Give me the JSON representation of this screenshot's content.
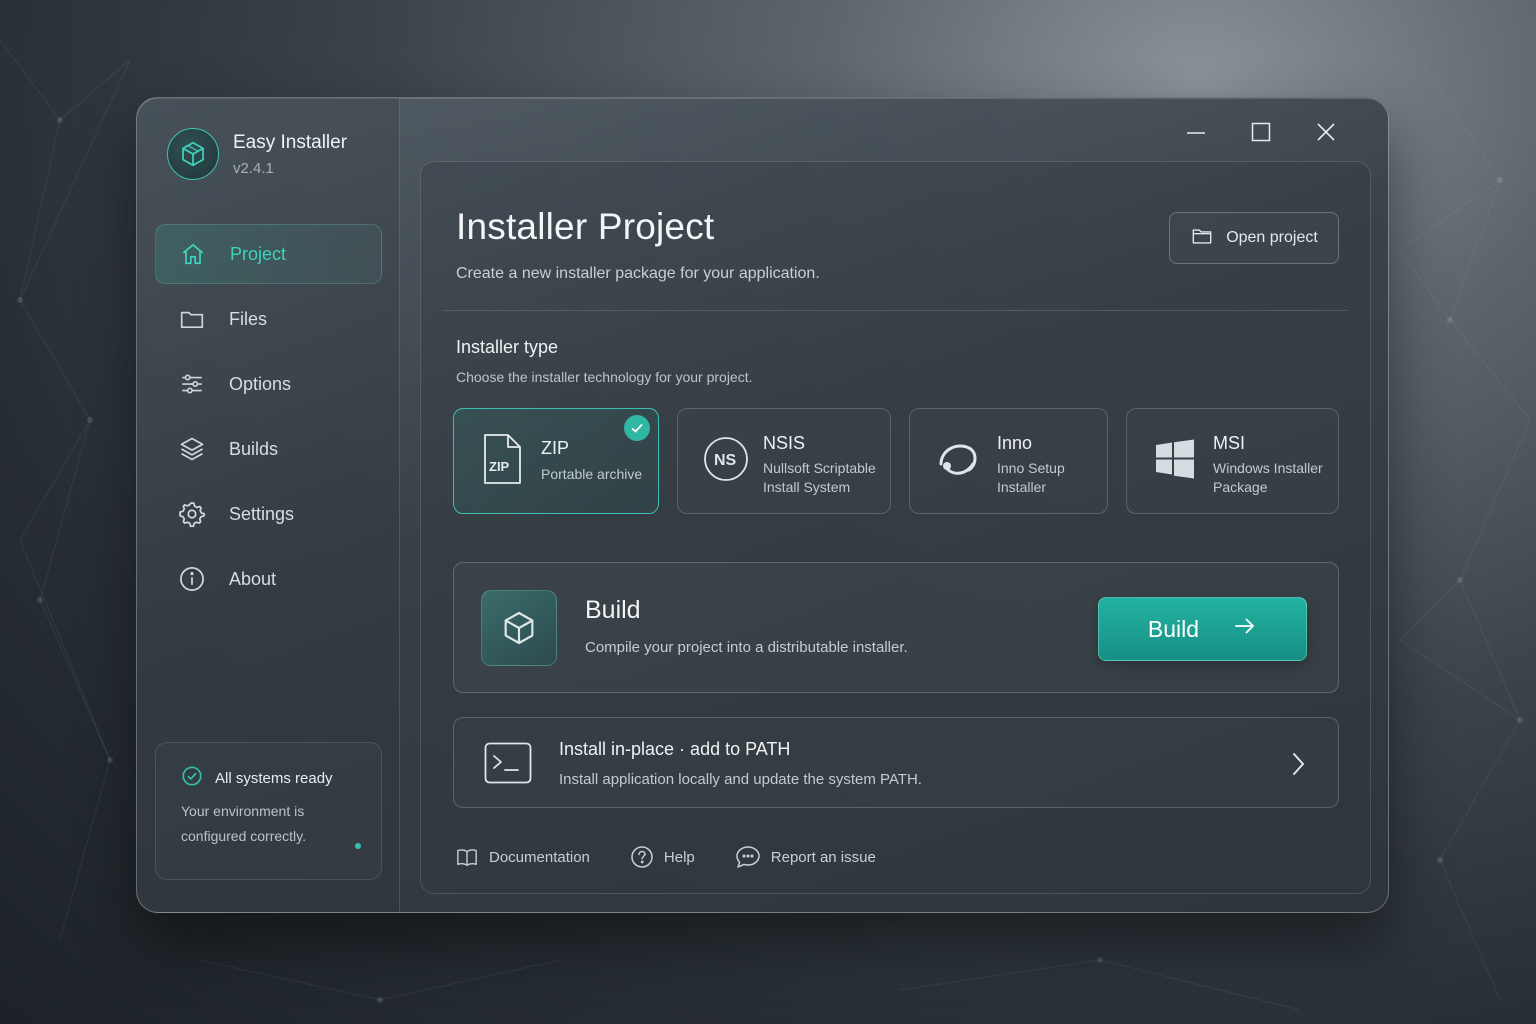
{
  "app": {
    "name": "Easy Installer",
    "version": "v2.4.1"
  },
  "colors": {
    "accent": "#3cc5b1",
    "accent_button": "#1fa596"
  },
  "sidebar": {
    "items": [
      {
        "label": "Project",
        "icon": "home-icon",
        "active": true
      },
      {
        "label": "Files",
        "icon": "folder-icon",
        "active": false
      },
      {
        "label": "Options",
        "icon": "sliders-icon",
        "active": false
      },
      {
        "label": "Builds",
        "icon": "layers-icon",
        "active": false
      },
      {
        "label": "Settings",
        "icon": "gear-icon",
        "active": false
      },
      {
        "label": "About",
        "icon": "info-icon",
        "active": false
      }
    ],
    "status": {
      "title": "All systems ready",
      "message": "Your environment is configured correctly."
    }
  },
  "window_controls": [
    "minimize-icon",
    "maximize-icon",
    "close-icon"
  ],
  "main": {
    "title": "Installer Project",
    "subtitle": "Create a new installer package for your application.",
    "open_project_label": "Open project",
    "installer_type": {
      "title": "Installer type",
      "subtitle": "Choose the installer technology for your project.",
      "options": [
        {
          "name": "ZIP",
          "desc_line1": "Portable archive",
          "desc_line2": "",
          "icon": "zip-file-icon",
          "icon_text": "ZIP",
          "selected": true
        },
        {
          "name": "NSIS",
          "desc_line1": "Nullsoft Scriptable",
          "desc_line2": "Install System",
          "icon": "nsis-icon",
          "icon_text": "NS",
          "selected": false
        },
        {
          "name": "Inno",
          "desc_line1": "Inno Setup",
          "desc_line2": "Installer",
          "icon": "inno-setup-icon",
          "selected": false
        },
        {
          "name": "MSI",
          "desc_line1": "Windows Installer",
          "desc_line2": "Package",
          "icon": "windows-icon",
          "selected": false
        }
      ]
    },
    "build": {
      "title": "Build",
      "subtitle": "Compile your project into a distributable installer.",
      "button_label": "Build"
    },
    "install": {
      "title": "Install in-place · add to PATH",
      "subtitle": "Install application locally and update the system PATH."
    },
    "footer_links": [
      {
        "label": "Documentation",
        "icon": "book-icon"
      },
      {
        "label": "Help",
        "icon": "help-circle-icon"
      },
      {
        "label": "Report an issue",
        "icon": "chat-bubble-icon"
      }
    ]
  }
}
